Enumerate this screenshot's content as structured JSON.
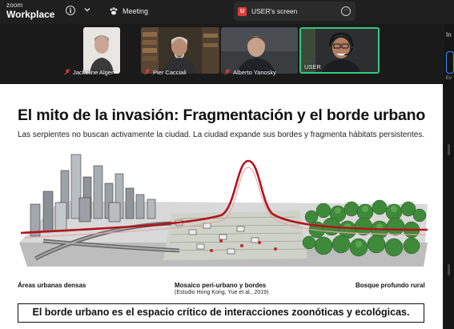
{
  "app": {
    "brand_top": "zoom",
    "brand_main": "Workplace",
    "meeting_label": "Meeting",
    "share_badge": "U",
    "share_label": "USER's screen",
    "more_glyph": "···"
  },
  "participants": [
    {
      "name": "Jackeline Alger",
      "muted": true
    },
    {
      "name": "Pier Cacciali",
      "muted": true
    },
    {
      "name": "Alberto Yanosky",
      "muted": true
    },
    {
      "name": "USER",
      "muted": false,
      "active_speaker": true
    }
  ],
  "side_panel": {
    "title": "In",
    "sub": "Ev"
  },
  "slide": {
    "title": "El mito de la invasión: Fragmentación y el borde urbano",
    "subtitle": "Las serpientes no buscan activamente la ciudad. La ciudad expande sus bordes y fragmenta hábitats persistentes.",
    "caption_left": "Áreas urbanas densas",
    "caption_mid": "Mosaico peri-urbano y bordes",
    "caption_mid_sub": "(Estudio Hong Kong, Yue et al., 2019)",
    "caption_right": "Bosque profundo rural",
    "conclusion": "El borde urbano es el espacio crítico de interacciones zoonóticas y ecológicas."
  },
  "colors": {
    "active_speaker_border": "#35c77d",
    "share_badge": "#e03b3b",
    "curve": "#b3131b",
    "forest": "#3f8a3a"
  }
}
